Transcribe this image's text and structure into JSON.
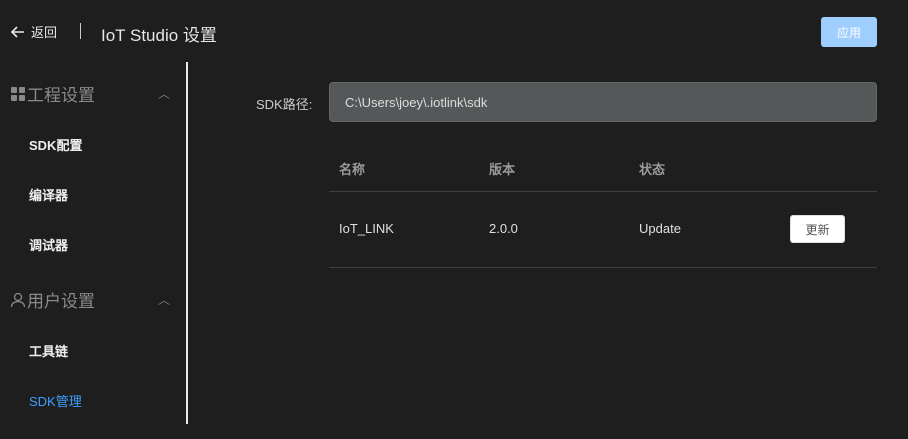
{
  "header": {
    "back_label": "返回",
    "title": "IoT Studio 设置",
    "apply_label": "应用"
  },
  "sidebar": {
    "groups": [
      {
        "label": "工程设置",
        "icon": "grid-icon",
        "items": [
          "SDK配置",
          "编译器",
          "调试器"
        ]
      },
      {
        "label": "用户设置",
        "icon": "user-icon",
        "items": [
          "工具链",
          "SDK管理"
        ]
      }
    ],
    "active": "SDK管理"
  },
  "main": {
    "sdk_path_label": "SDK路径:",
    "sdk_path_value": "C:\\Users\\joey\\.iotlink\\sdk",
    "table": {
      "headers": [
        "名称",
        "版本",
        "状态"
      ],
      "rows": [
        {
          "name": "IoT_LINK",
          "version": "2.0.0",
          "status": "Update",
          "action": "更新"
        }
      ]
    }
  },
  "colors": {
    "accent": "#409eff",
    "apply_button": "#a0cfff",
    "background": "#1e1e1e"
  }
}
